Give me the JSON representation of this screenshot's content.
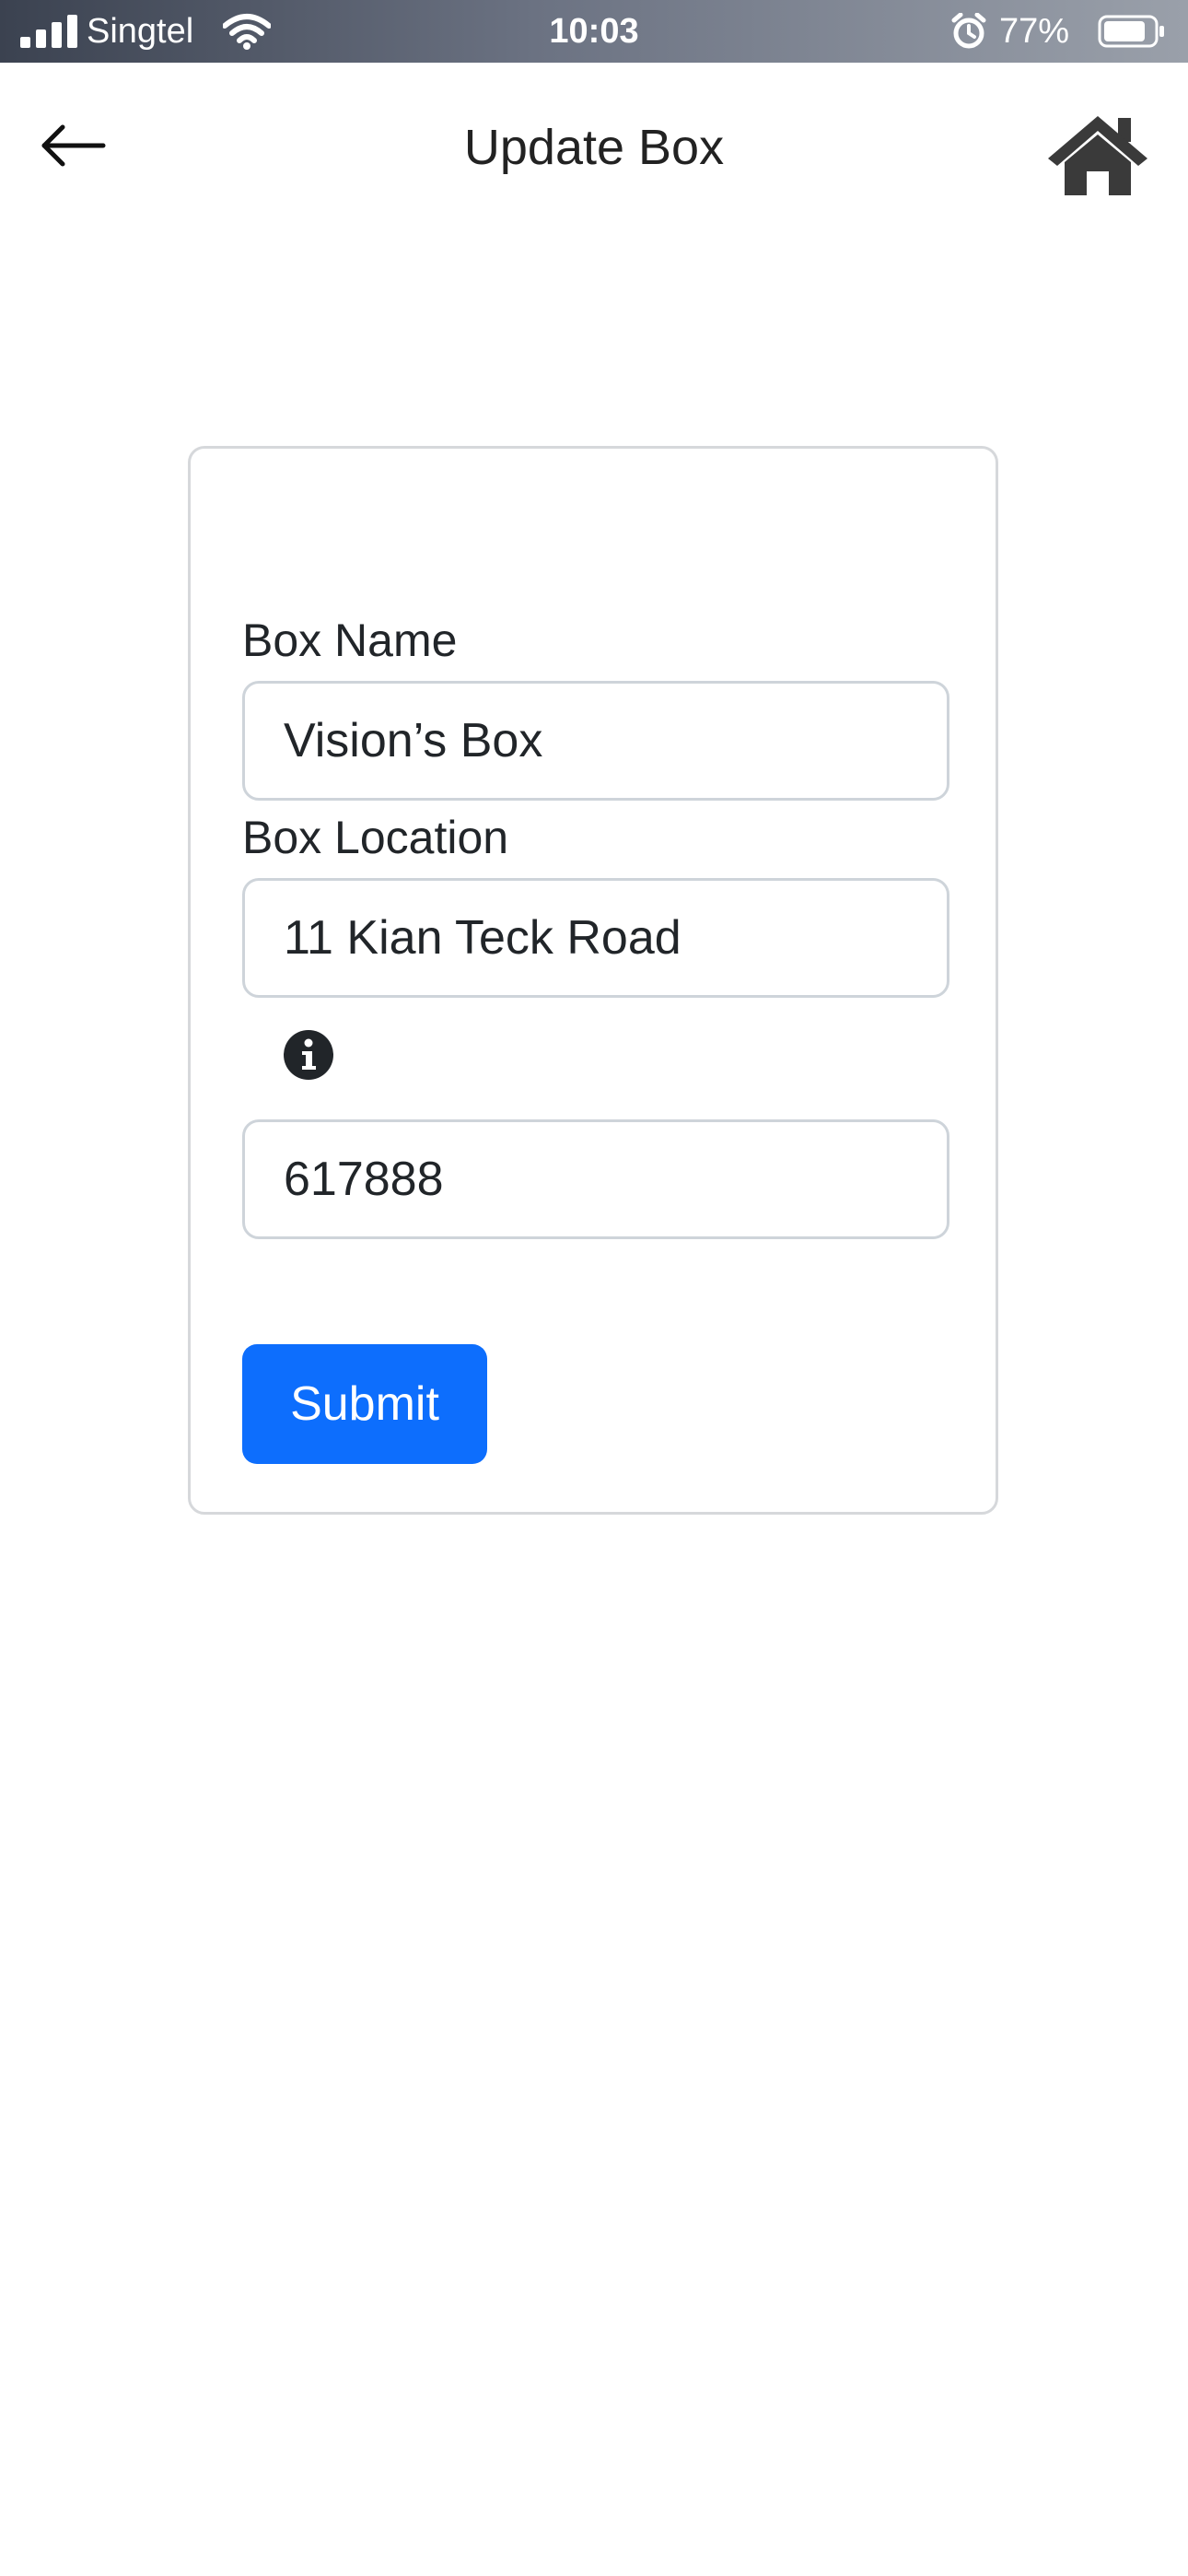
{
  "status_bar": {
    "carrier": "Singtel",
    "time": "10:03",
    "battery_percent": "77%",
    "icons": [
      "signal-icon",
      "wifi-icon",
      "alarm-icon",
      "battery-icon"
    ]
  },
  "header": {
    "title": "Update Box",
    "back_icon": "arrow-left-icon",
    "home_icon": "home-icon"
  },
  "form": {
    "box_name": {
      "label": "Box Name",
      "value": "Vision’s Box"
    },
    "box_location": {
      "label": "Box Location",
      "value": "11 Kian Teck Road"
    },
    "postal_code": {
      "info_icon": "info-circle-icon",
      "value": "617888"
    },
    "submit_label": "Submit"
  },
  "colors": {
    "primary": "#0d6efd",
    "border": "#ced4da",
    "text": "#212529"
  }
}
